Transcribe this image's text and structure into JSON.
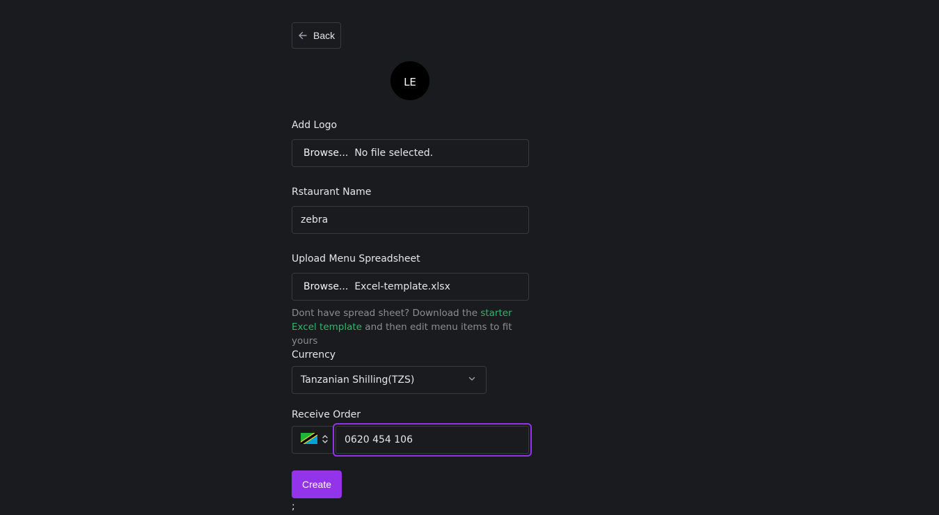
{
  "back_button": {
    "label": "Back"
  },
  "avatar": {
    "initials": "LE"
  },
  "add_logo": {
    "label": "Add Logo",
    "browse_label": "Browse...",
    "file_name": "No file selected."
  },
  "restaurant_name": {
    "label": "Rstaurant Name",
    "value": "zebra"
  },
  "menu_upload": {
    "label": "Upload Menu Spreadsheet",
    "browse_label": "Browse...",
    "file_name": "Excel-template.xlsx"
  },
  "help_text": {
    "prefix": "Dont have spread sheet? Download the ",
    "link": "starter Excel template",
    "suffix": " and then edit menu items to fit yours"
  },
  "currency": {
    "label": "Currency",
    "selected": "Tanzanian Shilling(TZS)"
  },
  "receive_order": {
    "label": "Receive Order",
    "country_flag": "tanzania-flag",
    "phone_value": "0620 454 106"
  },
  "create_button": {
    "label": "Create"
  },
  "trailing_text": ";",
  "colors": {
    "background": "#1a1b1f",
    "accent": "#9333ea",
    "link": "#2eb86b",
    "border": "#3a3b40"
  }
}
